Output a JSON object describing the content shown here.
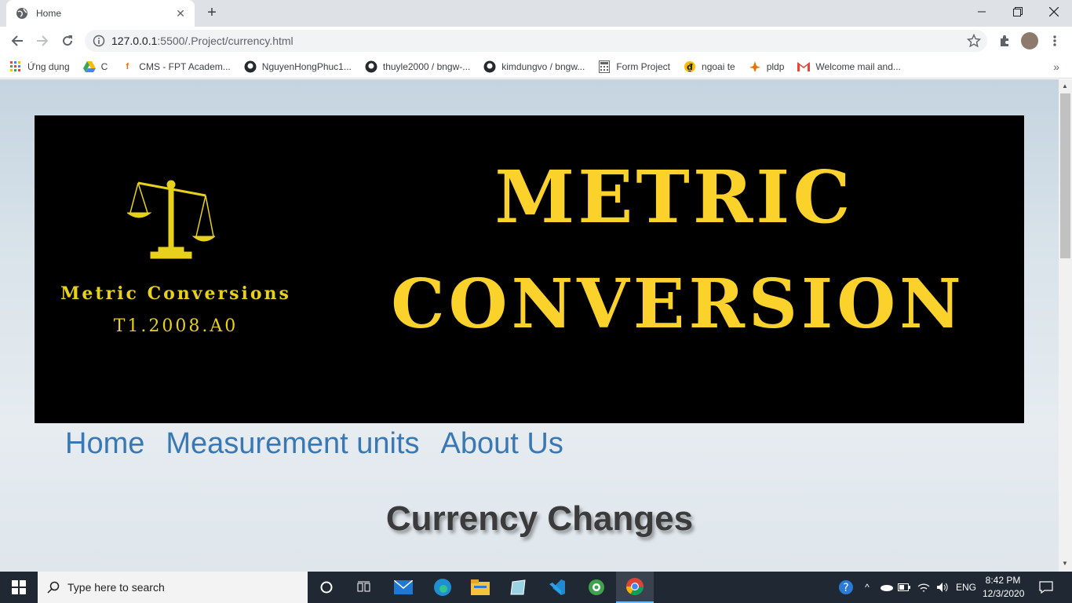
{
  "browser": {
    "tab_title": "Home",
    "url_host": "127.0.0.1",
    "url_rest": ":5500/.Project/currency.html",
    "bookmarks": [
      {
        "icon": "apps-grid-icon",
        "label": "Ứng dụng"
      },
      {
        "icon": "google-drive-icon",
        "label": "C"
      },
      {
        "icon": "fpt-icon",
        "label": "CMS - FPT Academ..."
      },
      {
        "icon": "github-icon",
        "label": "NguyenHongPhuc1..."
      },
      {
        "icon": "github-icon",
        "label": "thuyle2000 / bngw-..."
      },
      {
        "icon": "github-icon",
        "label": "kimdungvo / bngw..."
      },
      {
        "icon": "calculator-icon",
        "label": "Form Project"
      },
      {
        "icon": "exchange-icon",
        "label": "ngoai te"
      },
      {
        "icon": "plane-icon",
        "label": "pldp"
      },
      {
        "icon": "gmail-icon",
        "label": "Welcome mail and..."
      }
    ]
  },
  "page": {
    "banner": {
      "logo_title": "Metric Conversions",
      "logo_sub": "T1.2008.A0",
      "headline_line1": "METRIC",
      "headline_line2": "CONVERSION"
    },
    "nav": [
      "Home",
      "Measurement units",
      "About Us"
    ],
    "heading": "Currency Changes"
  },
  "taskbar": {
    "search_placeholder": "Type here to search",
    "language": "ENG",
    "time": "8:42 PM",
    "date": "12/3/2020"
  },
  "colors": {
    "banner_bg": "#000000",
    "headline": "#fbd12c",
    "nav_link": "#3a78b4",
    "heading": "#3b3b3b"
  }
}
